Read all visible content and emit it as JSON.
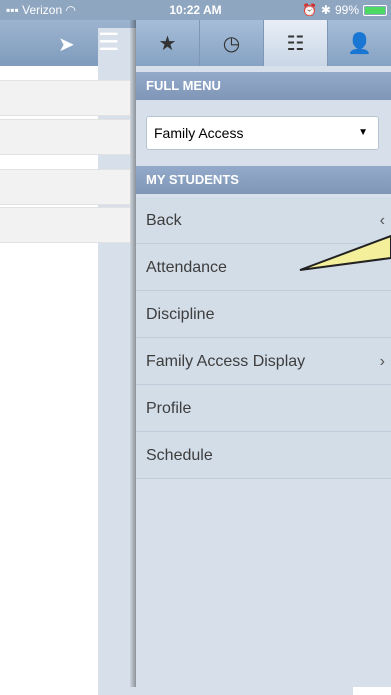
{
  "status_bar": {
    "carrier": "Verizon",
    "time": "10:22 AM",
    "battery": "99%"
  },
  "left_panel": {
    "icons": [
      "send-icon",
      "hamburger-icon"
    ]
  },
  "tabs": [
    {
      "icon": "star-icon"
    },
    {
      "icon": "clock-icon"
    },
    {
      "icon": "list-icon",
      "active": true
    },
    {
      "icon": "user-icon"
    }
  ],
  "full_menu": {
    "header": "FULL MENU",
    "selected": "Family Access"
  },
  "my_students": {
    "header": "MY STUDENTS",
    "items": [
      {
        "label": "Back",
        "chevron": "‹"
      },
      {
        "label": "Attendance",
        "chevron": ""
      },
      {
        "label": "Discipline",
        "chevron": ""
      },
      {
        "label": "Family Access Display",
        "chevron": "›"
      },
      {
        "label": "Profile",
        "chevron": ""
      },
      {
        "label": "Schedule",
        "chevron": ""
      }
    ]
  }
}
